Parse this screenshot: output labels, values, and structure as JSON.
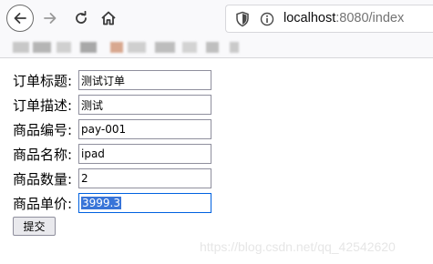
{
  "browser": {
    "url_host": "localhost",
    "url_rest": ":8080/index",
    "icons": [
      "back-icon",
      "forward-icon",
      "reload-icon",
      "home-icon",
      "shield-icon",
      "info-icon"
    ]
  },
  "bookmarks": {
    "colors": [
      "#c8c8c8",
      "#b5b5b5",
      "#d0d0d0",
      "#a8a8a8",
      "#d8a890",
      "#cfcfcf",
      "#bdbdbd",
      "#d3d3d3",
      "#bfbfbf",
      "#cacaca"
    ]
  },
  "form": {
    "rows": [
      {
        "label": "订单标题:",
        "value": "测试订单"
      },
      {
        "label": "订单描述:",
        "value": "测试"
      },
      {
        "label": "商品编号:",
        "value": "pay-001"
      },
      {
        "label": "商品名称:",
        "value": "ipad"
      },
      {
        "label": "商品数量:",
        "value": "2"
      },
      {
        "label": "商品单价:",
        "value": "3999.3"
      }
    ],
    "submit_label": "提交"
  },
  "watermark": "https://blog.csdn.net/qq_42542620"
}
